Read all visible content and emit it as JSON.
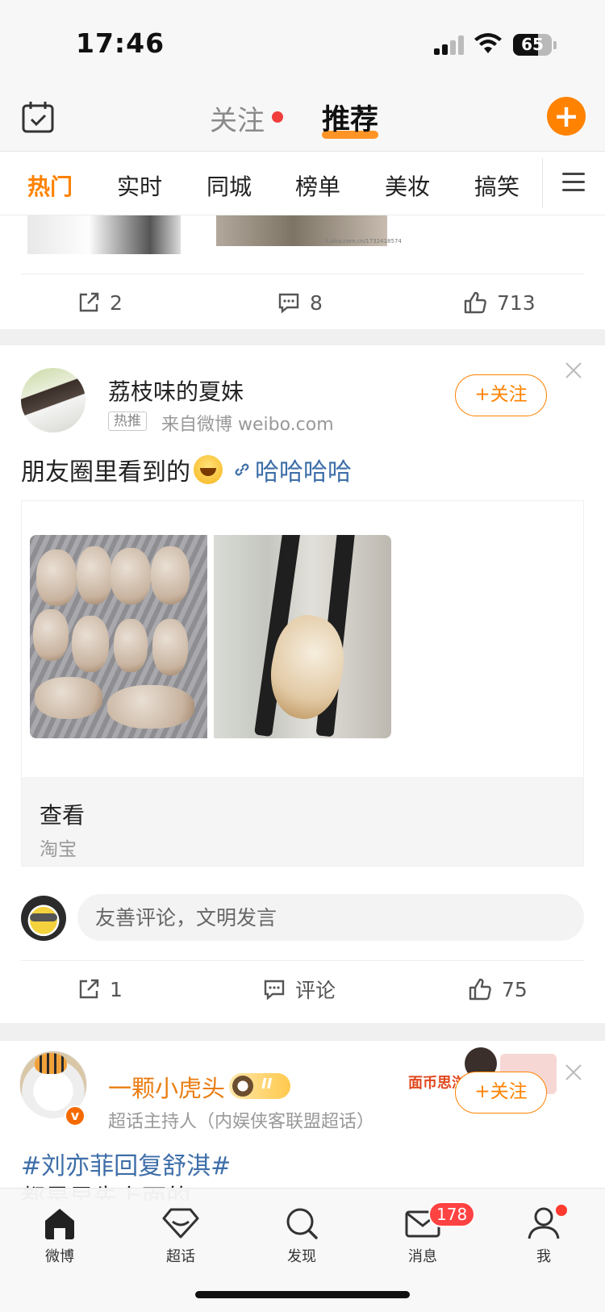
{
  "status_bar": {
    "time": "17:46",
    "battery": "65"
  },
  "top_nav": {
    "follow_label": "关注",
    "recommend_label": "推荐",
    "compose_label": "+"
  },
  "channels": [
    "热门",
    "实时",
    "同城",
    "榜单",
    "美妆",
    "搞笑"
  ],
  "prev_post": {
    "watermark": "t.sina.com.cn/1732418574",
    "stats": {
      "repost": "2",
      "comment": "8",
      "like": "713"
    }
  },
  "post": {
    "username": "荔枝味的夏妹",
    "tag": "热推",
    "source": "来自微博 weibo.com",
    "follow_label": "+关注",
    "text": "朋友圈里看到的",
    "link_text": "哈哈哈哈",
    "product": {
      "title": "查看",
      "subtitle": "淘宝"
    },
    "comment_placeholder": "友善评论，文明发言",
    "stats": {
      "repost": "1",
      "comment": "评论",
      "like": "75"
    }
  },
  "next_post": {
    "username": "一颗小虎头",
    "role": "超话主持人（内娱侠客联盟超话）",
    "follow_label": "+关注",
    "promo_text": "面币思浏",
    "topic": "#刘亦菲回复舒淇#",
    "text_peek": "都是早先上面的"
  },
  "tab_bar": {
    "items": [
      {
        "label": "微博"
      },
      {
        "label": "超话"
      },
      {
        "label": "发现"
      },
      {
        "label": "消息",
        "badge": "178"
      },
      {
        "label": "我"
      }
    ]
  },
  "colors": {
    "accent": "#ff8200",
    "link": "#3d6ea8",
    "badge": "#ff4242"
  }
}
